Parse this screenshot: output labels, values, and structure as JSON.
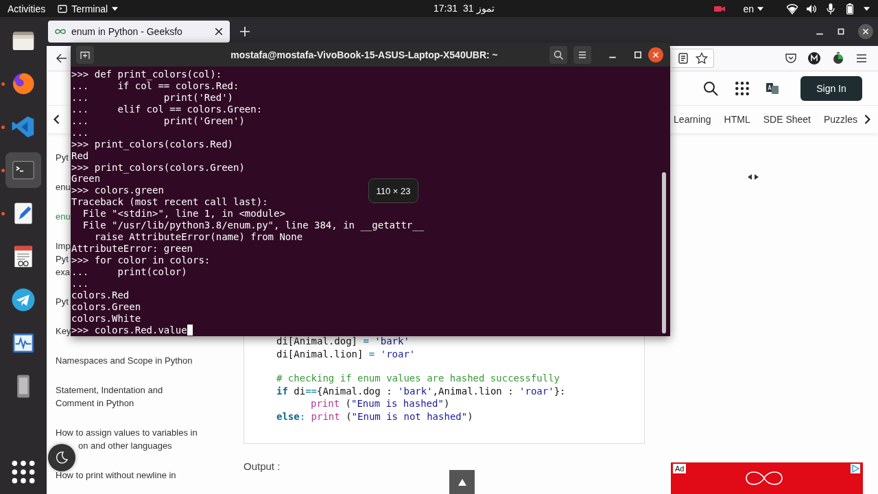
{
  "top_bar": {
    "activities": "Activities",
    "app_menu": "Terminal",
    "time": "17:31",
    "date": "31 تموز",
    "language": "en"
  },
  "dock": [
    {
      "kind": "files",
      "running": false,
      "selected": false
    },
    {
      "kind": "browser",
      "running": true,
      "selected": false
    },
    {
      "kind": "code",
      "running": true,
      "selected": false
    },
    {
      "kind": "terminal",
      "running": true,
      "selected": true
    },
    {
      "kind": "editor",
      "running": true,
      "selected": false
    },
    {
      "kind": "document",
      "running": false,
      "selected": false
    },
    {
      "kind": "messenger",
      "running": false,
      "selected": false
    },
    {
      "kind": "monitor",
      "running": false,
      "selected": false
    },
    {
      "kind": "device",
      "running": false,
      "selected": false
    }
  ],
  "browser": {
    "tab": {
      "title": "enum in Python - Geeksfo"
    },
    "header": {
      "sign_in": "Sign In"
    },
    "site_nav": [
      "Learning",
      "HTML",
      "SDE Sheet",
      "Puzzles"
    ],
    "sidebar": [
      {
        "kind": "link",
        "lines": [
          "Pyt"
        ],
        "selected": false
      },
      {
        "kind": "link",
        "lines": [
          "enu"
        ],
        "selected": false
      },
      {
        "kind": "link",
        "lines": [
          "enu"
        ],
        "selected": true
      },
      {
        "kind": "link",
        "lines": [
          "Imp",
          "Pyt",
          "exa"
        ],
        "selected": false
      },
      {
        "kind": "link",
        "lines": [
          "Pyt"
        ],
        "selected": false
      },
      {
        "kind": "link",
        "lines": [
          "Key"
        ],
        "selected": false
      },
      {
        "kind": "link",
        "lines": [
          "Namespaces and Scope in Python"
        ],
        "selected": false
      },
      {
        "kind": "link",
        "lines": [
          "Statement, Indentation and",
          "Comment in Python"
        ],
        "selected": false
      },
      {
        "kind": "covered",
        "lines": [
          "How to assign values to variables in",
          "on and other languages"
        ],
        "selected": false
      },
      {
        "kind": "link",
        "lines": [
          "How to print without newline in"
        ],
        "selected": false
      }
    ],
    "code_blocks": [
      [
        {
          "indented": false,
          "tokens": [
            {
              "kind": "plain",
              "text": "di[Animal.dog] "
            },
            {
              "kind": "op",
              "text": "= "
            },
            {
              "kind": "string",
              "text": "'bark'"
            }
          ]
        },
        {
          "indented": false,
          "tokens": [
            {
              "kind": "plain",
              "text": "di[Animal.lion] "
            },
            {
              "kind": "op",
              "text": "= "
            },
            {
              "kind": "string",
              "text": "'roar'"
            }
          ]
        }
      ],
      [
        {
          "indented": false,
          "tokens": [
            {
              "kind": "comment",
              "text": "# checking if enum values are hashed successfully"
            }
          ]
        },
        {
          "indented": false,
          "tokens": [
            {
              "kind": "keyword",
              "text": "if "
            },
            {
              "kind": "plain",
              "text": "di"
            },
            {
              "kind": "op",
              "text": "=="
            },
            {
              "kind": "plain",
              "text": "{Animal.dog : "
            },
            {
              "kind": "string",
              "text": "'bark'"
            },
            {
              "kind": "plain",
              "text": ",Animal.lion : "
            },
            {
              "kind": "string",
              "text": "'roar'"
            },
            {
              "kind": "plain",
              "text": "}:"
            }
          ]
        },
        {
          "indented": true,
          "tokens": [
            {
              "kind": "builtin",
              "text": "print "
            },
            {
              "kind": "plain",
              "text": "("
            },
            {
              "kind": "string",
              "text": "\"Enum is hashed\""
            },
            {
              "kind": "plain",
              "text": ")"
            }
          ]
        },
        {
          "indented": false,
          "tokens": [
            {
              "kind": "keyword",
              "text": "else"
            },
            {
              "kind": "op",
              "text": ": "
            },
            {
              "kind": "builtin",
              "text": "print "
            },
            {
              "kind": "plain",
              "text": "("
            },
            {
              "kind": "string",
              "text": "\"Enum is not hashed\""
            },
            {
              "kind": "plain",
              "text": ")"
            }
          ]
        }
      ]
    ],
    "output_label": "Output :",
    "ad": {
      "label": "Ad"
    }
  },
  "terminal": {
    "title": "mostafa@mostafa-VivoBook-15-ASUS-Laptop-X540UBR: ~",
    "cursor": true,
    "lines": [
      ">>> def print_colors(col):",
      "...     if col == colors.Red:",
      "...             print('Red')",
      "...     elif col == colors.Green:",
      "...             print('Green')",
      "...",
      ">>> print_colors(colors.Red)",
      "Red",
      ">>> print_colors(colors.Green)",
      "Green",
      ">>> colors.green",
      "Traceback (most recent call last):",
      "  File \"<stdin>\", line 1, in <module>",
      "  File \"/usr/lib/python3.8/enum.py\", line 384, in __getattr__",
      "    raise AttributeError(name) from None",
      "AttributeError: green",
      ">>> for color in colors:",
      "...     print(color)",
      "...",
      "colors.Red",
      "colors.Green",
      "colors.White",
      ">>> colors.Red.value"
    ]
  },
  "tooltip": "110 × 23"
}
